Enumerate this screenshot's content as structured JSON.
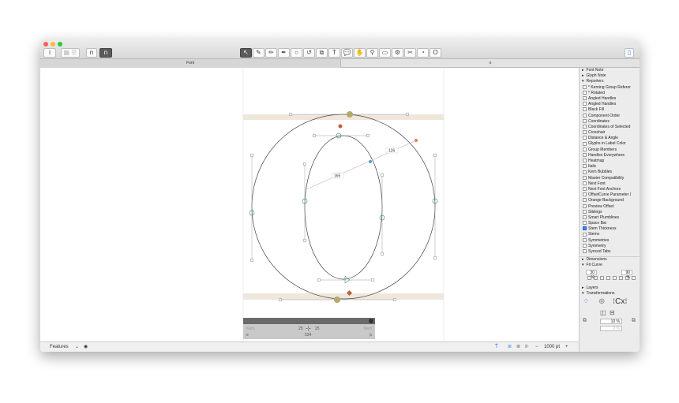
{
  "toolbar": {
    "info": "i",
    "glyph_n_outline": "n",
    "glyph_n_filled": "n",
    "tools": [
      "select-tool",
      "draw-tool",
      "pencil-tool",
      "pen-tool",
      "shape-tool",
      "rotate-tool",
      "scale-tool",
      "text-tool",
      "annotation-tool",
      "hand-tool",
      "zoom-tool",
      "measure-tool",
      "knife-tool",
      "scissor-tool",
      "erase-tool",
      "primitives-tool"
    ]
  },
  "tabs": [
    {
      "label": "Font"
    },
    {
      "label": "o"
    }
  ],
  "canvas": {
    "measure_1": "126",
    "measure_2": "165"
  },
  "info_box": {
    "kern_left_label": "Kern",
    "kern_right_label": "Kern",
    "lsb": "25",
    "rsb": "25",
    "width": "534",
    "left_glyph": "e",
    "right_glyph": "p"
  },
  "bottom": {
    "features": "Features",
    "zoom": "1000 pt",
    "minus": "−",
    "plus": "+"
  },
  "sidebar": {
    "font_note": "Font Note",
    "glyph_note": "Glyph Note",
    "reporters": "Reporters",
    "reporter_items": [
      {
        "label": "* Kerning Group Referer",
        "checked": false
      },
      {
        "label": "* Rotated",
        "checked": false
      },
      {
        "label": "Angled Handles",
        "checked": false
      },
      {
        "label": "Angled Handles",
        "checked": false
      },
      {
        "label": "Black Fill",
        "checked": false
      },
      {
        "label": "Component Order",
        "checked": false
      },
      {
        "label": "Coordinates",
        "checked": false
      },
      {
        "label": "Coordinates of Selected",
        "checked": false
      },
      {
        "label": "Crosshair",
        "checked": false
      },
      {
        "label": "Distance & Angle",
        "checked": false
      },
      {
        "label": "Glyphs in Label Color",
        "checked": false
      },
      {
        "label": "Group Members",
        "checked": false
      },
      {
        "label": "Handles Everywhere",
        "checked": false
      },
      {
        "label": "Heatmap",
        "checked": false
      },
      {
        "label": "Italic",
        "checked": false
      },
      {
        "label": "Kern Bubbles",
        "checked": false
      },
      {
        "label": "Master Compatibility",
        "checked": false
      },
      {
        "label": "Next Font",
        "checked": false
      },
      {
        "label": "Next Font Anchors",
        "checked": false
      },
      {
        "label": "OffsetCurve Parameter I",
        "checked": false
      },
      {
        "label": "Orange Background",
        "checked": false
      },
      {
        "label": "Preview Offset",
        "checked": false
      },
      {
        "label": "Siblings",
        "checked": false
      },
      {
        "label": "Smart Plumblines",
        "checked": false
      },
      {
        "label": "Space Bar",
        "checked": false
      },
      {
        "label": "Stem Thickness",
        "checked": true
      },
      {
        "label": "Stems",
        "checked": false
      },
      {
        "label": "Symmetries",
        "checked": false
      },
      {
        "label": "Symmetry",
        "checked": false
      },
      {
        "label": "Synced Tabs",
        "checked": false
      }
    ],
    "dimensions": "Dimensions",
    "fit_curve": "Fit Curve",
    "fit_min": "30 %",
    "fit_max": "90 %",
    "layers": "Layers",
    "transformations": "Transformations",
    "scale_value": "10 %",
    "rotate_value": "0 %"
  },
  "colors": {
    "accent": "#3b82f6",
    "band": "#efe6dc",
    "node_green": "#4a9a6a",
    "node_orange": "#c0603a"
  }
}
